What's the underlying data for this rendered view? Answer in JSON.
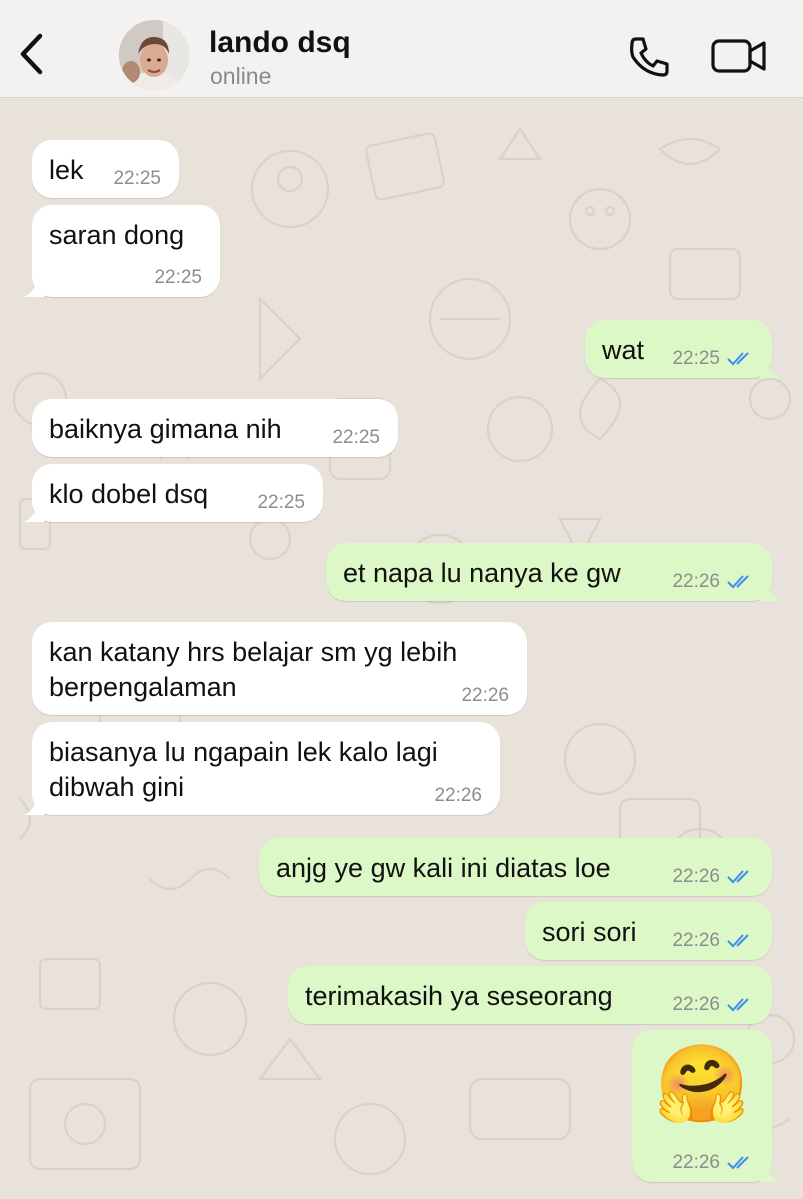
{
  "header": {
    "contact_name": "lando dsq",
    "status": "online"
  },
  "icons": {
    "back": "chevron-left-icon",
    "call": "phone-icon",
    "video": "video-camera-icon",
    "read": "double-check-icon"
  },
  "colors": {
    "incoming_bubble": "#ffffff",
    "outgoing_bubble": "#dcf8c6",
    "read_ticks": "#3d8ef0",
    "wallpaper": "#e8e2da"
  },
  "messages": [
    {
      "dir": "in",
      "text": "lek",
      "time": "22:25"
    },
    {
      "dir": "in",
      "text": "saran dong",
      "time": "22:25"
    },
    {
      "dir": "out",
      "text": "wat",
      "time": "22:25"
    },
    {
      "dir": "in",
      "text": "baiknya gimana nih",
      "time": "22:25"
    },
    {
      "dir": "in",
      "text": "klo dobel dsq",
      "time": "22:25"
    },
    {
      "dir": "out",
      "text": "et napa lu nanya ke gw",
      "time": "22:26"
    },
    {
      "dir": "in",
      "text": "kan katany hrs belajar sm yg lebih berpengalaman",
      "time": "22:26"
    },
    {
      "dir": "in",
      "text": "biasanya lu ngapain lek kalo lagi dibwah gini",
      "time": "22:26"
    },
    {
      "dir": "out",
      "text": "anjg ye gw kali ini diatas loe",
      "time": "22:26"
    },
    {
      "dir": "out",
      "text": "sori sori",
      "time": "22:26"
    },
    {
      "dir": "out",
      "text": "terimakasih ya seseorang",
      "time": "22:26"
    },
    {
      "dir": "out",
      "text": "🤗",
      "time": "22:26"
    }
  ]
}
